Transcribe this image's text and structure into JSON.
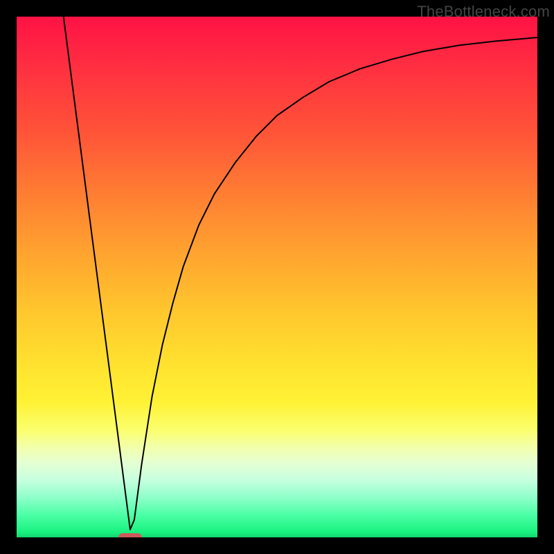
{
  "watermark": "TheBottleneck.com",
  "chart_data": {
    "type": "line",
    "title": "",
    "xlabel": "",
    "ylabel": "",
    "xlim": [
      0,
      100
    ],
    "ylim": [
      0,
      100
    ],
    "legend": false,
    "grid": false,
    "background": {
      "type": "vertical-gradient",
      "description": "red top through orange/yellow to green bottom",
      "stops": [
        {
          "pos": 0,
          "color": "#ff1244"
        },
        {
          "pos": 0.22,
          "color": "#ff5338"
        },
        {
          "pos": 0.46,
          "color": "#ffa52f"
        },
        {
          "pos": 0.67,
          "color": "#ffe22f"
        },
        {
          "pos": 0.8,
          "color": "#fbff6f"
        },
        {
          "pos": 0.9,
          "color": "#8bffc8"
        },
        {
          "pos": 1.0,
          "color": "#12d46e"
        }
      ]
    },
    "series": [
      {
        "name": "bottleneck-curve",
        "stroke": "#000000",
        "stroke_width": 2,
        "x": [
          9,
          11,
          13,
          15,
          17,
          19,
          21,
          21.8,
          22.6,
          24,
          26,
          28,
          30,
          32,
          35,
          38,
          42,
          46,
          50,
          55,
          60,
          66,
          72,
          78,
          85,
          92,
          100
        ],
        "y": [
          100,
          84.6,
          69.2,
          53.8,
          38.5,
          23.1,
          7.7,
          1.5,
          3.4,
          14,
          27,
          37,
          45,
          52,
          60,
          66,
          72,
          77,
          81,
          84.5,
          87.5,
          90,
          91.8,
          93.3,
          94.5,
          95.3,
          96
        ]
      }
    ],
    "markers": [
      {
        "name": "optimum-marker",
        "shape": "rounded-capsule",
        "x": 21.8,
        "y": 0,
        "width": 4.5,
        "height": 1.6,
        "color": "#cc5a5a"
      }
    ]
  }
}
